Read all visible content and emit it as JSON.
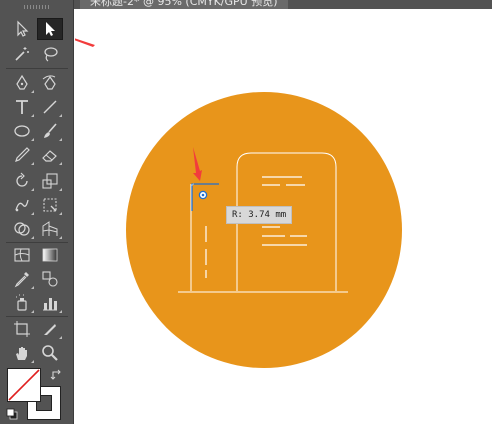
{
  "document_tab": {
    "title": "未标题-2* @ 95% (CMYK/GPU 预览)"
  },
  "toolbar": {
    "tools": [
      {
        "name": "selection-tool",
        "icon": "selection-arrow-icon"
      },
      {
        "name": "direct-selection-tool",
        "icon": "direct-selection-arrow-icon",
        "active": true
      },
      {
        "name": "magic-wand-tool",
        "icon": "magic-wand-icon"
      },
      {
        "name": "lasso-tool",
        "icon": "lasso-icon"
      },
      {
        "name": "pen-tool",
        "icon": "pen-icon"
      },
      {
        "name": "curvature-tool",
        "icon": "curvature-pen-icon"
      },
      {
        "name": "type-tool",
        "icon": "type-icon"
      },
      {
        "name": "line-segment-tool",
        "icon": "line-icon"
      },
      {
        "name": "ellipse-tool",
        "icon": "ellipse-icon"
      },
      {
        "name": "paintbrush-tool",
        "icon": "paintbrush-icon"
      },
      {
        "name": "pencil-tool",
        "icon": "pencil-icon"
      },
      {
        "name": "eraser-tool",
        "icon": "eraser-icon"
      },
      {
        "name": "rotate-tool",
        "icon": "rotate-icon"
      },
      {
        "name": "scale-tool",
        "icon": "scale-icon"
      },
      {
        "name": "puppet-warp-tool",
        "icon": "puppet-warp-icon"
      },
      {
        "name": "free-transform-tool",
        "icon": "free-transform-icon"
      },
      {
        "name": "shape-builder-tool",
        "icon": "shape-builder-icon"
      },
      {
        "name": "perspective-grid-tool",
        "icon": "perspective-grid-icon"
      },
      {
        "name": "mesh-tool",
        "icon": "mesh-icon"
      },
      {
        "name": "gradient-tool",
        "icon": "gradient-icon"
      },
      {
        "name": "eyedropper-tool",
        "icon": "eyedropper-icon"
      },
      {
        "name": "blend-tool",
        "icon": "blend-icon"
      },
      {
        "name": "symbol-sprayer-tool",
        "icon": "symbol-sprayer-icon"
      },
      {
        "name": "column-graph-tool",
        "icon": "column-graph-icon"
      },
      {
        "name": "artboard-tool",
        "icon": "artboard-icon"
      },
      {
        "name": "slice-tool",
        "icon": "slice-icon"
      },
      {
        "name": "hand-tool",
        "icon": "hand-icon"
      },
      {
        "name": "zoom-tool",
        "icon": "zoom-icon"
      }
    ],
    "fill_color": "#ffffff",
    "stroke_color": "#ffffff"
  },
  "canvas": {
    "circle_color": "#e8951b",
    "line_color": "#ffffff",
    "corner_widget_color": "#1f6fd1",
    "radius_readout": "R: 3.74 mm",
    "annotation_arrow_color": "#f23c3c"
  }
}
